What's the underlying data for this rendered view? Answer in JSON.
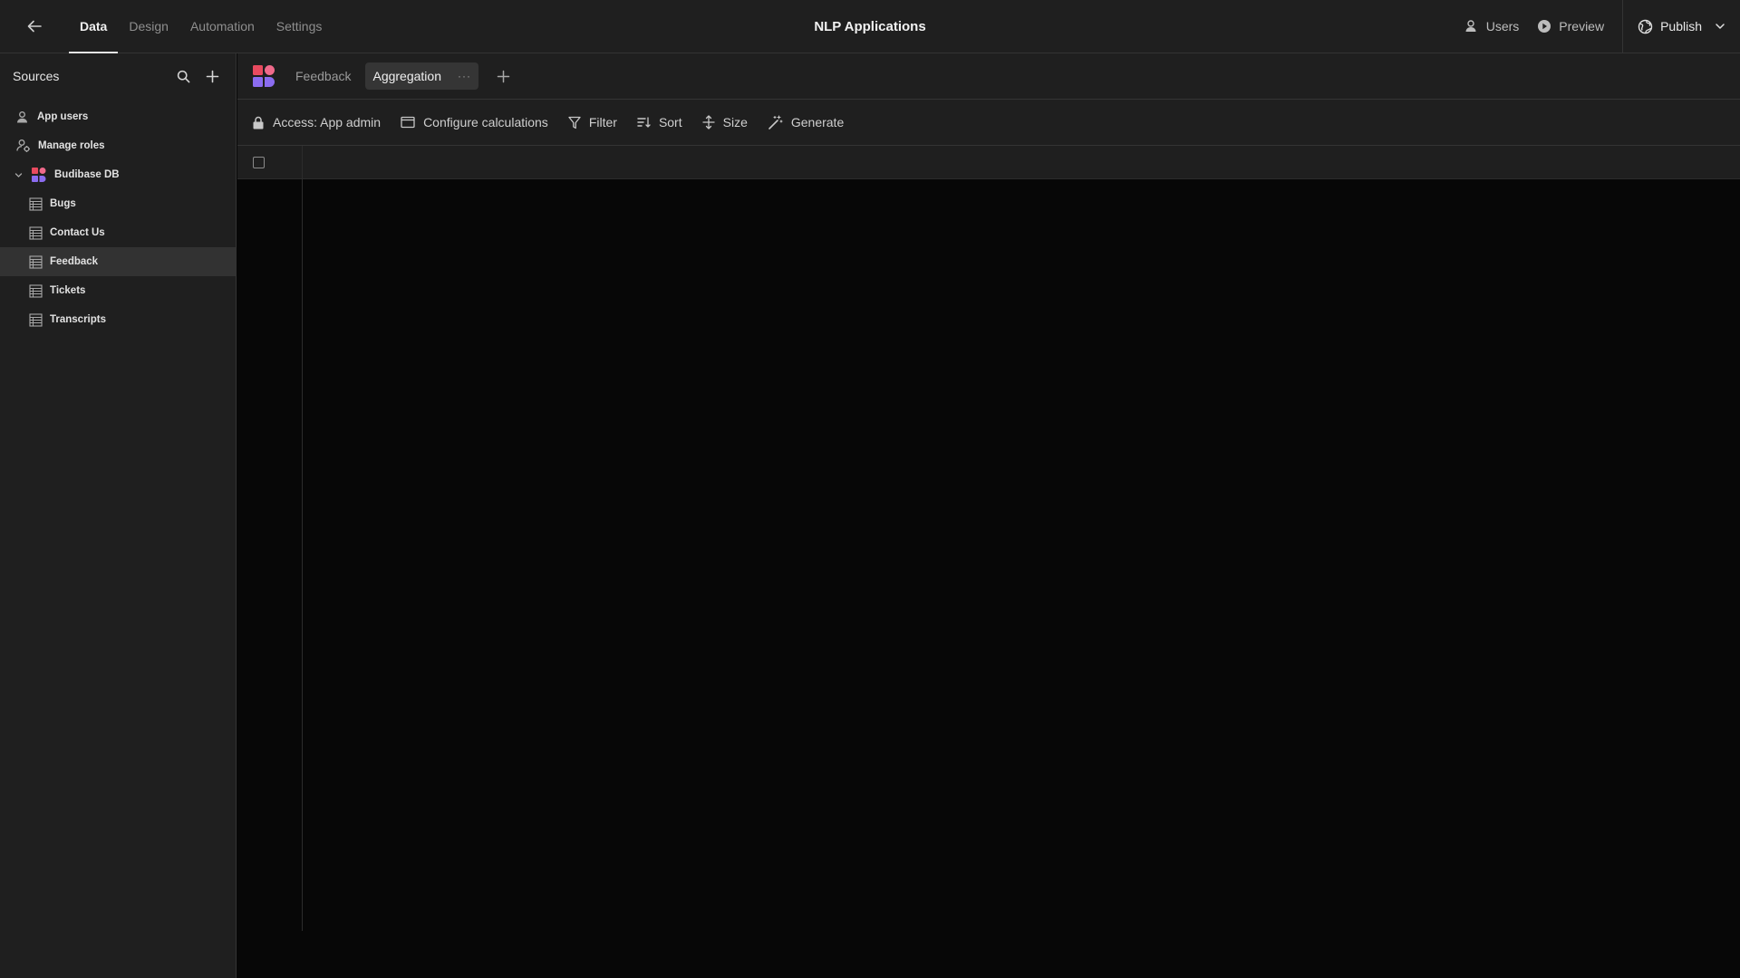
{
  "topbar": {
    "app_title": "NLP Applications",
    "tabs": [
      {
        "label": "Data",
        "active": true
      },
      {
        "label": "Design"
      },
      {
        "label": "Automation"
      },
      {
        "label": "Settings"
      }
    ],
    "users_label": "Users",
    "preview_label": "Preview",
    "publish_label": "Publish"
  },
  "sidebar": {
    "title": "Sources",
    "items": [
      {
        "label": "App users",
        "icon": "user-icon"
      },
      {
        "label": "Manage roles",
        "icon": "roles-icon"
      },
      {
        "label": "Budibase DB",
        "icon": "budibase-logo",
        "expanded": true
      },
      {
        "label": "Bugs",
        "icon": "table-icon"
      },
      {
        "label": "Contact Us",
        "icon": "table-icon"
      },
      {
        "label": "Feedback",
        "icon": "table-icon",
        "selected": true
      },
      {
        "label": "Tickets",
        "icon": "table-icon"
      },
      {
        "label": "Transcripts",
        "icon": "table-icon"
      }
    ]
  },
  "main": {
    "tabs": [
      {
        "label": "Feedback"
      },
      {
        "label": "Aggregation",
        "active": true,
        "more": "···"
      }
    ],
    "toolbar": {
      "access_label": "Access: App admin",
      "configure_label": "Configure calculations",
      "filter_label": "Filter",
      "sort_label": "Sort",
      "size_label": "Size",
      "generate_label": "Generate"
    }
  },
  "colors": {
    "panel_bg": "#1f1f1f",
    "canvas_bg": "#070707",
    "selected_bg": "#323232",
    "logo_pink": "#f06a8b",
    "logo_purple": "#8b6cf0",
    "logo_red": "#e84a5f"
  }
}
